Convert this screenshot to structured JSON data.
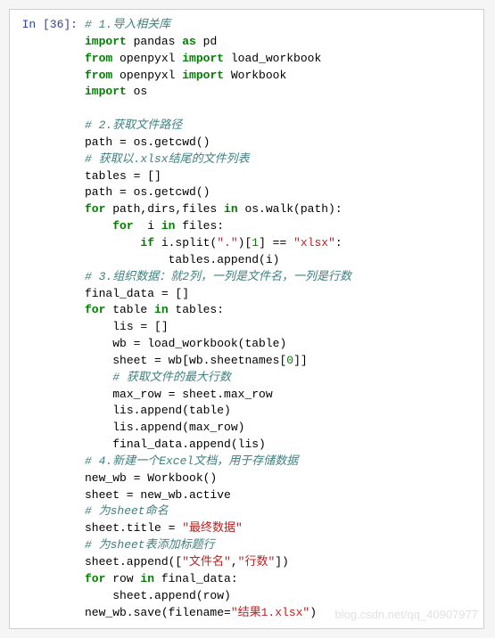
{
  "prompt": "In [36]:",
  "watermark": "blog.csdn.net/qq_40907977",
  "code": {
    "c1": "# 1.导入相关库",
    "l2a": "import",
    "l2b": " pandas ",
    "l2c": "as",
    "l2d": " pd",
    "l3a": "from",
    "l3b": " openpyxl ",
    "l3c": "import",
    "l3d": " load_workbook",
    "l4a": "from",
    "l4b": " openpyxl ",
    "l4c": "import",
    "l4d": " Workbook",
    "l5a": "import",
    "l5b": " os",
    "c2": "# 2.获取文件路径",
    "l7": "path = os.getcwd()",
    "c3": "# 获取以.xlsx结尾的文件列表",
    "l9": "tables = []",
    "l10": "path = os.getcwd()",
    "l11a": "for",
    "l11b": " path,dirs,files ",
    "l11c": "in",
    "l11d": " os.walk(path):",
    "l12a": "for",
    "l12b": "  i ",
    "l12c": "in",
    "l12d": " files:",
    "l13a": "if",
    "l13b": " i.split(",
    "l13s1": "\".\"",
    "l13c": ")[",
    "l13n": "1",
    "l13d": "] == ",
    "l13s2": "\"xlsx\"",
    "l13e": ":",
    "l14": "tables.append(i)",
    "c4": "# 3.组织数据：就2列，一列是文件名，一列是行数",
    "l16": "final_data = []",
    "l17a": "for",
    "l17b": " table ",
    "l17c": "in",
    "l17d": " tables:",
    "l18": "lis = []",
    "l19": "wb = load_workbook(table)",
    "l20a": "sheet = wb[wb.sheetnames[",
    "l20n": "0",
    "l20b": "]]",
    "c5": "# 获取文件的最大行数",
    "l22": "max_row = sheet.max_row",
    "l23": "lis.append(table)",
    "l24": "lis.append(max_row)",
    "l25": "final_data.append(lis)",
    "c6": "# 4.新建一个Excel文档，用于存储数据",
    "l27": "new_wb = Workbook()",
    "l28": "sheet = new_wb.active",
    "c7": "# 为sheet命名",
    "l30a": "sheet.title = ",
    "l30s": "\"最终数据\"",
    "c8": "# 为sheet表添加标题行",
    "l32a": "sheet.append([",
    "l32s1": "\"文件名\"",
    "l32b": ",",
    "l32s2": "\"行数\"",
    "l32c": "])",
    "l33a": "for",
    "l33b": " row ",
    "l33c": "in",
    "l33d": " final_data:",
    "l34": "sheet.append(row)",
    "l35a": "new_wb.save(filename=",
    "l35s": "\"结果1.xlsx\"",
    "l35b": ")"
  }
}
